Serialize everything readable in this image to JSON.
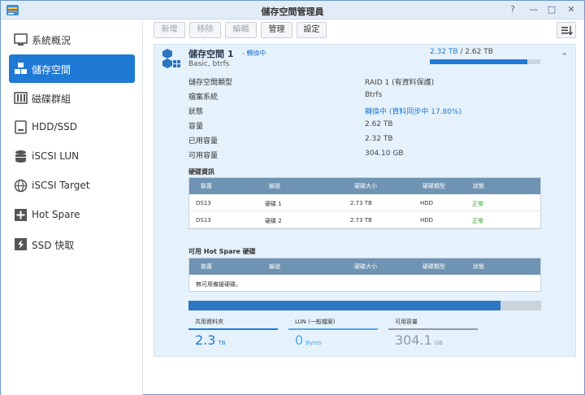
{
  "window": {
    "title": "儲存空間管理員"
  },
  "window_controls": {
    "help": "?",
    "minimize": "—",
    "maximize": "□",
    "close": "✕"
  },
  "sidebar": {
    "items": [
      {
        "label": "系統概況",
        "icon": "overview-icon"
      },
      {
        "label": "儲存空間",
        "icon": "volume-icon"
      },
      {
        "label": "磁碟群組",
        "icon": "disk-group-icon"
      },
      {
        "label": "HDD/SSD",
        "icon": "hdd-icon"
      },
      {
        "label": "iSCSI LUN",
        "icon": "iscsi-lun-icon"
      },
      {
        "label": "iSCSI Target",
        "icon": "iscsi-target-icon"
      },
      {
        "label": "Hot Spare",
        "icon": "hot-spare-icon"
      },
      {
        "label": "SSD 快取",
        "icon": "ssd-cache-icon"
      }
    ]
  },
  "toolbar": {
    "create": "新增",
    "remove": "移除",
    "edit": "編輯",
    "manage": "管理",
    "settings": "設定"
  },
  "volume": {
    "name": "儲存空間 1",
    "status_tag": "- 轉換中",
    "subtitle": "Basic, btrfs",
    "used": "2.32 TB",
    "separator": " / ",
    "total": "2.62 TB",
    "usage_fraction": 0.885,
    "properties": [
      {
        "label": "儲存空間類型",
        "value": "RAID 1 (有資料保護)",
        "highlight": false
      },
      {
        "label": "檔案系統",
        "value": "Btrfs",
        "highlight": false
      },
      {
        "label": "狀態",
        "value": "轉換中 (資料同步中 17.80%)",
        "highlight": true
      },
      {
        "label": "容量",
        "value": "2.62 TB",
        "highlight": false
      },
      {
        "label": "已用容量",
        "value": "2.32 TB",
        "highlight": false
      },
      {
        "label": "可用容量",
        "value": "304.10 GB",
        "highlight": false
      }
    ]
  },
  "disk_info": {
    "title": "硬碟資訊",
    "columns": [
      "裝置",
      "編號",
      "硬碟大小",
      "硬碟類型",
      "狀態"
    ],
    "rows": [
      {
        "device": "DS13",
        "id": "硬碟 1",
        "size": "2.73 TB",
        "type": "HDD",
        "status": "正常"
      },
      {
        "device": "DS13",
        "id": "硬碟 2",
        "size": "2.73 TB",
        "type": "HDD",
        "status": "正常"
      }
    ]
  },
  "hot_spare": {
    "title": "可用 Hot Spare 硬碟",
    "columns": [
      "裝置",
      "編號",
      "硬碟大小",
      "硬碟類型",
      "狀態"
    ],
    "empty_text": "無可用備援硬碟。"
  },
  "capacity_fraction": 0.885,
  "stats": [
    {
      "label": "共用資料夾",
      "value": "2.3",
      "unit": "TB",
      "color": "#1f7ad6"
    },
    {
      "label": "LUN (一般檔案)",
      "value": "0",
      "unit": "Bytes",
      "color": "#53a6e6"
    },
    {
      "label": "可用容量",
      "value": "304.1",
      "unit": "GB",
      "color": "#8f9aa5"
    }
  ],
  "colors": {
    "accent": "#1f7ad6",
    "ok": "#2a9d2a",
    "panel": "#e6f2fb"
  }
}
